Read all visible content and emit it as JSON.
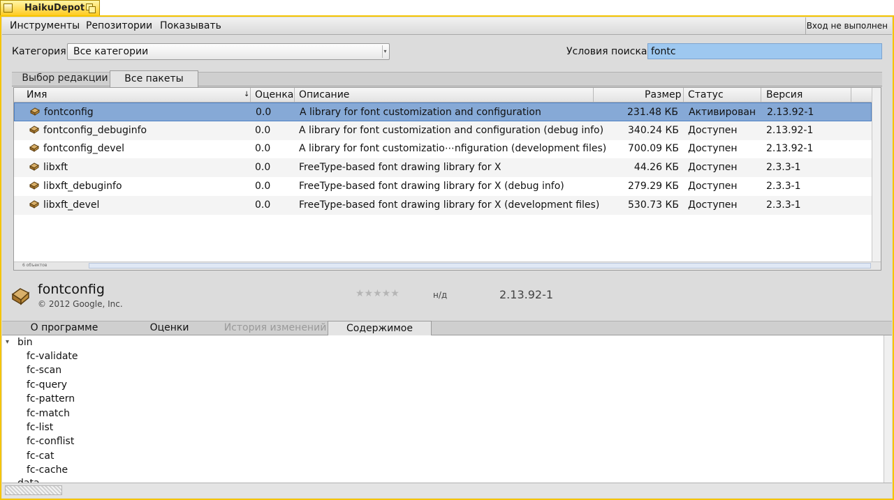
{
  "window": {
    "title": "HaikuDepot",
    "frame_color": "#f5c400"
  },
  "menu": {
    "items": [
      "Инструменты",
      "Репозитории",
      "Показывать"
    ],
    "login": "Вход не выполнен"
  },
  "filters": {
    "category_label": "Категория:",
    "category_value": "Все категории",
    "search_label": "Условия поиска:",
    "search_value": "fontc"
  },
  "top_tabs": {
    "editors": "Выбор редакции",
    "all": "Все пакеты",
    "active": "all"
  },
  "table": {
    "columns": {
      "name": "Имя",
      "rating": "Оценка",
      "description": "Описание",
      "size": "Размер",
      "status": "Статус",
      "version": "Версия"
    },
    "selected_index": 0,
    "rows": [
      {
        "name": "fontconfig",
        "rating": "0.0",
        "description": "A library for font customization and configuration",
        "size": "231.48 КБ",
        "status": "Активирован",
        "version": "2.13.92-1"
      },
      {
        "name": "fontconfig_debuginfo",
        "rating": "0.0",
        "description": "A library for font customization and configuration (debug info)",
        "size": "340.24 КБ",
        "status": "Доступен",
        "version": "2.13.92-1"
      },
      {
        "name": "fontconfig_devel",
        "rating": "0.0",
        "description": "A library for font customizatio⋯nfiguration (development files)",
        "size": "700.09 КБ",
        "status": "Доступен",
        "version": "2.13.92-1"
      },
      {
        "name": "libxft",
        "rating": "0.0",
        "description": "FreeType-based font drawing library for X",
        "size": "44.26 КБ",
        "status": "Доступен",
        "version": "2.3.3-1"
      },
      {
        "name": "libxft_debuginfo",
        "rating": "0.0",
        "description": "FreeType-based font drawing library for X (debug info)",
        "size": "279.29 КБ",
        "status": "Доступен",
        "version": "2.3.3-1"
      },
      {
        "name": "libxft_devel",
        "rating": "0.0",
        "description": "FreeType-based font drawing library for X (development files)",
        "size": "530.73 КБ",
        "status": "Доступен",
        "version": "2.3.3-1"
      }
    ],
    "count_text": "6 объектов"
  },
  "detail": {
    "title": "fontconfig",
    "copyright": "© 2012 Google, Inc.",
    "stars": "★★★★★",
    "rating_text": "н/д",
    "version": "2.13.92-1"
  },
  "bottom_tabs": {
    "about": "О программе",
    "ratings": "Оценки",
    "history": "История изменений",
    "contents": "Содержимое"
  },
  "contents": {
    "folder": "bin",
    "files": [
      "fc-validate",
      "fc-scan",
      "fc-query",
      "fc-pattern",
      "fc-match",
      "fc-list",
      "fc-conflist",
      "fc-cat",
      "fc-cache"
    ],
    "next_folder": "data"
  },
  "colors": {
    "selection": "#86a9d6",
    "search_bg": "#9ec8f0",
    "tab_gold": "#ffcb21"
  }
}
